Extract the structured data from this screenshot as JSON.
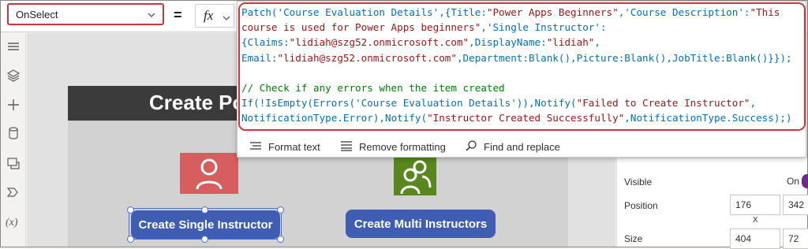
{
  "formula_bar": {
    "property": "OnSelect",
    "equals": "=",
    "fx_label": "fx"
  },
  "editor": {
    "lines": [
      [
        {
          "t": "Patch(",
          "c": "fn"
        },
        {
          "t": "'Course Evaluation Details'",
          "c": "fn"
        },
        {
          "t": ",{Title:",
          "c": "fn"
        },
        {
          "t": "\"Power Apps Beginners\"",
          "c": "str"
        },
        {
          "t": ",'Course Description':",
          "c": "fn"
        },
        {
          "t": "\"This",
          "c": "str"
        }
      ],
      [
        {
          "t": "course is used for Power Apps beginners\"",
          "c": "str"
        },
        {
          "t": ",'Single Instructor':",
          "c": "fn"
        }
      ],
      [
        {
          "t": "{Claims:",
          "c": "fn"
        },
        {
          "t": "\"lidiah@szg52.onmicrosoft.com\"",
          "c": "str"
        },
        {
          "t": ",DisplayName:",
          "c": "fn"
        },
        {
          "t": "\"lidiah\"",
          "c": "str"
        },
        {
          "t": ",",
          "c": "fn"
        }
      ],
      [
        {
          "t": "Email:",
          "c": "fn"
        },
        {
          "t": "\"lidiah@szg52.onmicrosoft.com\"",
          "c": "str"
        },
        {
          "t": ",Department:",
          "c": "fn"
        },
        {
          "t": "Blank",
          "c": "kw"
        },
        {
          "t": "(),Picture:",
          "c": "fn"
        },
        {
          "t": "Blank",
          "c": "kw"
        },
        {
          "t": "(),JobTitle:",
          "c": "fn"
        },
        {
          "t": "Blank",
          "c": "kw"
        },
        {
          "t": "()}});",
          "c": "fn"
        }
      ],
      [],
      [
        {
          "t": "// Check if any errors when the item created",
          "c": "cm"
        }
      ],
      [
        {
          "t": "If(!IsEmpty(Errors(",
          "c": "fn"
        },
        {
          "t": "'Course Evaluation Details'",
          "c": "fn"
        },
        {
          "t": ")),Notify(",
          "c": "fn"
        },
        {
          "t": "\"Failed to Create Instructor\"",
          "c": "str"
        },
        {
          "t": ",",
          "c": "fn"
        }
      ],
      [
        {
          "t": "NotificationType.",
          "c": "fn"
        },
        {
          "t": "Error",
          "c": "kw"
        },
        {
          "t": "),Notify(",
          "c": "fn"
        },
        {
          "t": "\"Instructor Created Successfully\"",
          "c": "str"
        },
        {
          "t": ",NotificationType.Success);)",
          "c": "fn"
        }
      ]
    ],
    "footer": {
      "format_text": "Format text",
      "remove_formatting": "Remove formatting",
      "find_replace": "Find and replace"
    }
  },
  "canvas": {
    "title": "Create Po",
    "btn_single": "Create Single Instructor",
    "btn_multi": "Create Multi Instructors"
  },
  "properties": {
    "visible_label": "Visible",
    "visible_value": "On",
    "position_label": "Position",
    "pos_x": "176",
    "pos_y": "342",
    "x_label": "X",
    "size_label": "Size",
    "size_w": "404",
    "size_h": "72"
  },
  "colors": {
    "accent_red": "#d13438",
    "button_blue": "#3f5eb3",
    "tile_red": "#d65e5e",
    "tile_green": "#57871e"
  },
  "icons": [
    "menu-icon",
    "layers-icon",
    "add-icon",
    "database-icon",
    "media-icon",
    "power-automate-icon",
    "variables-icon",
    "user-icon",
    "users-icon",
    "chevron-down-icon",
    "format-text-icon",
    "remove-formatting-icon",
    "search-icon"
  ]
}
